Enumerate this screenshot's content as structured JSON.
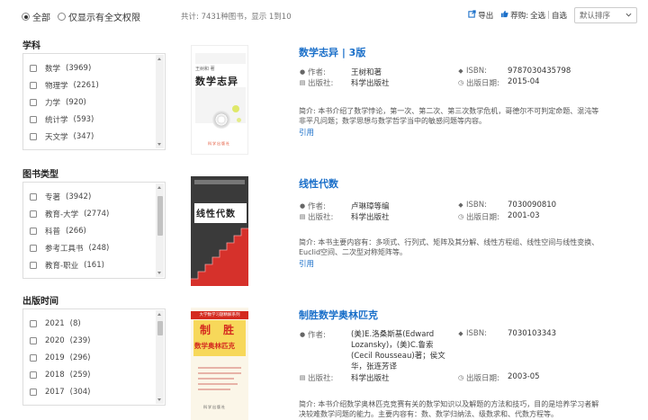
{
  "filter": {
    "all_label": "全部",
    "fulltext_label": "仅显示有全文权限"
  },
  "total_text": "共计: 7431种图书，显示 1到10",
  "actions": {
    "export_label": "导出",
    "recommend_label": "荐购:",
    "select_all": "全选",
    "separator": "|",
    "select_self": "自选"
  },
  "sort": {
    "value": "默认排序"
  },
  "sections": [
    {
      "title": "学科",
      "items": [
        {
          "label": "数学",
          "count": "(3969)"
        },
        {
          "label": "物理学",
          "count": "(2261)"
        },
        {
          "label": "力学",
          "count": "(920)"
        },
        {
          "label": "统计学",
          "count": "(593)"
        },
        {
          "label": "天文学",
          "count": "(347)"
        }
      ]
    },
    {
      "title": "图书类型",
      "items": [
        {
          "label": "专著",
          "count": "(3942)"
        },
        {
          "label": "教育-大学",
          "count": "(2774)"
        },
        {
          "label": "科普",
          "count": "(266)"
        },
        {
          "label": "参考工具书",
          "count": "(248)"
        },
        {
          "label": "教育-职业",
          "count": "(161)"
        }
      ]
    },
    {
      "title": "出版时间",
      "items": [
        {
          "label": "2021",
          "count": "(8)"
        },
        {
          "label": "2020",
          "count": "(239)"
        },
        {
          "label": "2019",
          "count": "(296)"
        },
        {
          "label": "2018",
          "count": "(259)"
        },
        {
          "label": "2017",
          "count": "(304)"
        }
      ]
    }
  ],
  "labels": {
    "author": "作者:",
    "publisher": "出版社:",
    "isbn": "ISBN:",
    "pubdate": "出版日期:",
    "summary_prefix": "简介:",
    "cite": "引用"
  },
  "books": [
    {
      "title": "数学志异 | 3版",
      "author": "王树和著",
      "publisher": "科学出版社",
      "isbn": "9787030435798",
      "pubdate": "2015-04",
      "summary": "本书介绍了数学悖论，第一次、第二次、第三次数学危机，哥德尔不可判定命题、混沌等非平凡问题；数学思想与数学哲学当中的敏感问题等内容。",
      "cover_title": "数学志异",
      "cover_author": "王树和 著",
      "cover_publisher": "科学出版社"
    },
    {
      "title": "线性代数",
      "author": "卢琳璋等编",
      "publisher": "科学出版社",
      "isbn": "7030090810",
      "pubdate": "2001-03",
      "summary": "本书主要内容有：多项式、行列式、矩阵及其分解、线性方程组、线性空间与线性变换、Euclid空间、二次型对称矩阵等。",
      "cover_title": "线性代数"
    },
    {
      "title": "制胜数学奥林匹克",
      "author": "(美)E.洛桑斯基(Edward Lozansky)，(美)C.鲁索(Cecil Rousseau)著；侯文华，张连芳译",
      "publisher": "科学出版社",
      "isbn": "7030103343",
      "pubdate": "2003-05",
      "summary": "本书介绍数学奥林匹克竞赛有关的数学知识以及解题的方法和技巧，目的是培养学习者解决较难数学问题的能力。主要内容有：数、数学归纳法、级数求和、代数方程等。",
      "cover_series": "大学数学习题精解系列",
      "cover_title_1": "制",
      "cover_title_2": "胜",
      "cover_title_3": "数学奥林匹克",
      "cover_publisher": "科学出版社"
    }
  ],
  "colors": {
    "link": "#1a6fc9",
    "cover2_bg": "#3a3a3a",
    "cover2_stairs": "#d6312b",
    "cover3_yellow": "#f7d85a",
    "cover3_red": "#d42a1f"
  }
}
